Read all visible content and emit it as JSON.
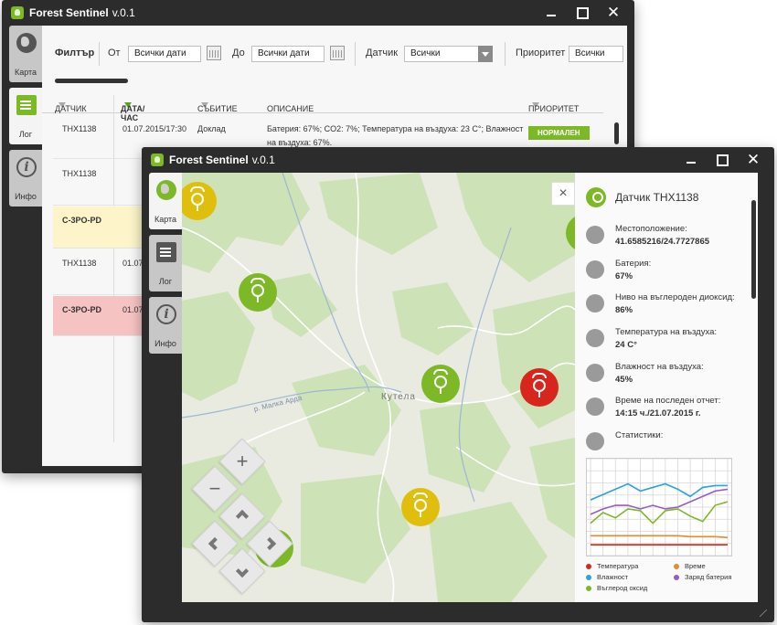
{
  "app": {
    "name": "Forest Sentinel",
    "version": "v.0.1"
  },
  "sidebar": {
    "tabs": [
      {
        "label": "Карта",
        "icon": "globe-icon"
      },
      {
        "label": "Лог",
        "icon": "document-icon"
      },
      {
        "label": "Инфо",
        "icon": "info-icon"
      }
    ]
  },
  "filter": {
    "title": "Филтър",
    "from_label": "От",
    "from_value": "Всички дати",
    "to_label": "До",
    "to_value": "Всички дати",
    "sensor_label": "Датчик",
    "sensor_value": "Всички",
    "priority_label": "Приоритет",
    "priority_value": "Всички"
  },
  "log_table": {
    "columns": [
      "ДАТЧИК",
      "ДАТА/ЧАС",
      "СЪБИТИЕ",
      "ОПИСАНИЕ",
      "ПРИОРИТЕТ"
    ],
    "rows": [
      {
        "sensor": "THX1138",
        "datetime": "01.07.2015/17:30",
        "event": "Доклад",
        "description": "Батерия: 67%; CO2: 7%; Температура на въздуха: 23 C°; Влажност",
        "description2": "на въздуха: 67%.",
        "priority": "НОРМАЛЕН",
        "highlight": "none"
      },
      {
        "sensor": "THX1138",
        "datetime": "",
        "event": "",
        "description": "",
        "description2": "",
        "priority": "",
        "highlight": "none"
      },
      {
        "sensor": "C-3PO-PD",
        "datetime": "",
        "event": "",
        "description": "",
        "description2": "",
        "priority": "",
        "highlight": "yellow"
      },
      {
        "sensor": "THX1138",
        "datetime": "01.07.",
        "event": "",
        "description": "",
        "description2": "",
        "priority": "",
        "highlight": "none"
      },
      {
        "sensor": "C-3PO-PD",
        "datetime": "01.07.",
        "event": "",
        "description": "",
        "description2": "",
        "priority": "",
        "highlight": "red"
      }
    ]
  },
  "map": {
    "place_label": "Кутела",
    "river_label": "р. Малка Арда",
    "zoom_in": "+",
    "zoom_out": "−",
    "close": "×"
  },
  "detail": {
    "title": "Датчик THX1138",
    "fields": [
      {
        "label": "Местоположение:",
        "value": "41.6585216/24.7727865",
        "icon": "location-pin-icon"
      },
      {
        "label": "Батерия:",
        "value": "67%",
        "icon": "battery-icon"
      },
      {
        "label": "Ниво на въглероден диоксид:",
        "value": "86%",
        "icon": "co2-icon"
      },
      {
        "label": "Температура на въздуха:",
        "value": "24 C°",
        "icon": "thermometer-icon"
      },
      {
        "label": "Влажност на въздуха:",
        "value": "45%",
        "icon": "droplet-icon"
      },
      {
        "label": "Време на последен отчет:",
        "value": "14:15 ч./21.07.2015 г.",
        "icon": "stopwatch-icon"
      },
      {
        "label": "Статистики:",
        "value": "",
        "icon": "chart-icon"
      }
    ]
  },
  "chart_data": {
    "type": "line",
    "x": [
      1,
      2,
      3,
      4,
      5,
      6,
      7,
      8,
      9,
      10,
      11,
      12
    ],
    "ylim": [
      0,
      100
    ],
    "series": [
      {
        "name": "Температура",
        "color": "#d9261c",
        "values": [
          8,
          8,
          8,
          8,
          8,
          8,
          8,
          8,
          8,
          8,
          8,
          8
        ]
      },
      {
        "name": "Време",
        "color": "#e8892b",
        "values": [
          18,
          18,
          18,
          18,
          18,
          18,
          18,
          18,
          17,
          17,
          17,
          16
        ]
      },
      {
        "name": "Влажност",
        "color": "#2aa3e0",
        "values": [
          58,
          64,
          70,
          76,
          68,
          72,
          76,
          70,
          62,
          72,
          74,
          74
        ]
      },
      {
        "name": "Заряд батерия",
        "color": "#9b59c6",
        "values": [
          42,
          48,
          52,
          52,
          48,
          52,
          48,
          50,
          56,
          62,
          68,
          70
        ]
      },
      {
        "name": "Въглерод оксид",
        "color": "#7db827",
        "values": [
          32,
          44,
          38,
          48,
          46,
          32,
          46,
          48,
          40,
          34,
          52,
          56
        ]
      }
    ]
  },
  "colors": {
    "accent": "#7db827",
    "warning": "#e0be0c",
    "alert": "#d9261c",
    "chrome": "#2c2c2c"
  }
}
